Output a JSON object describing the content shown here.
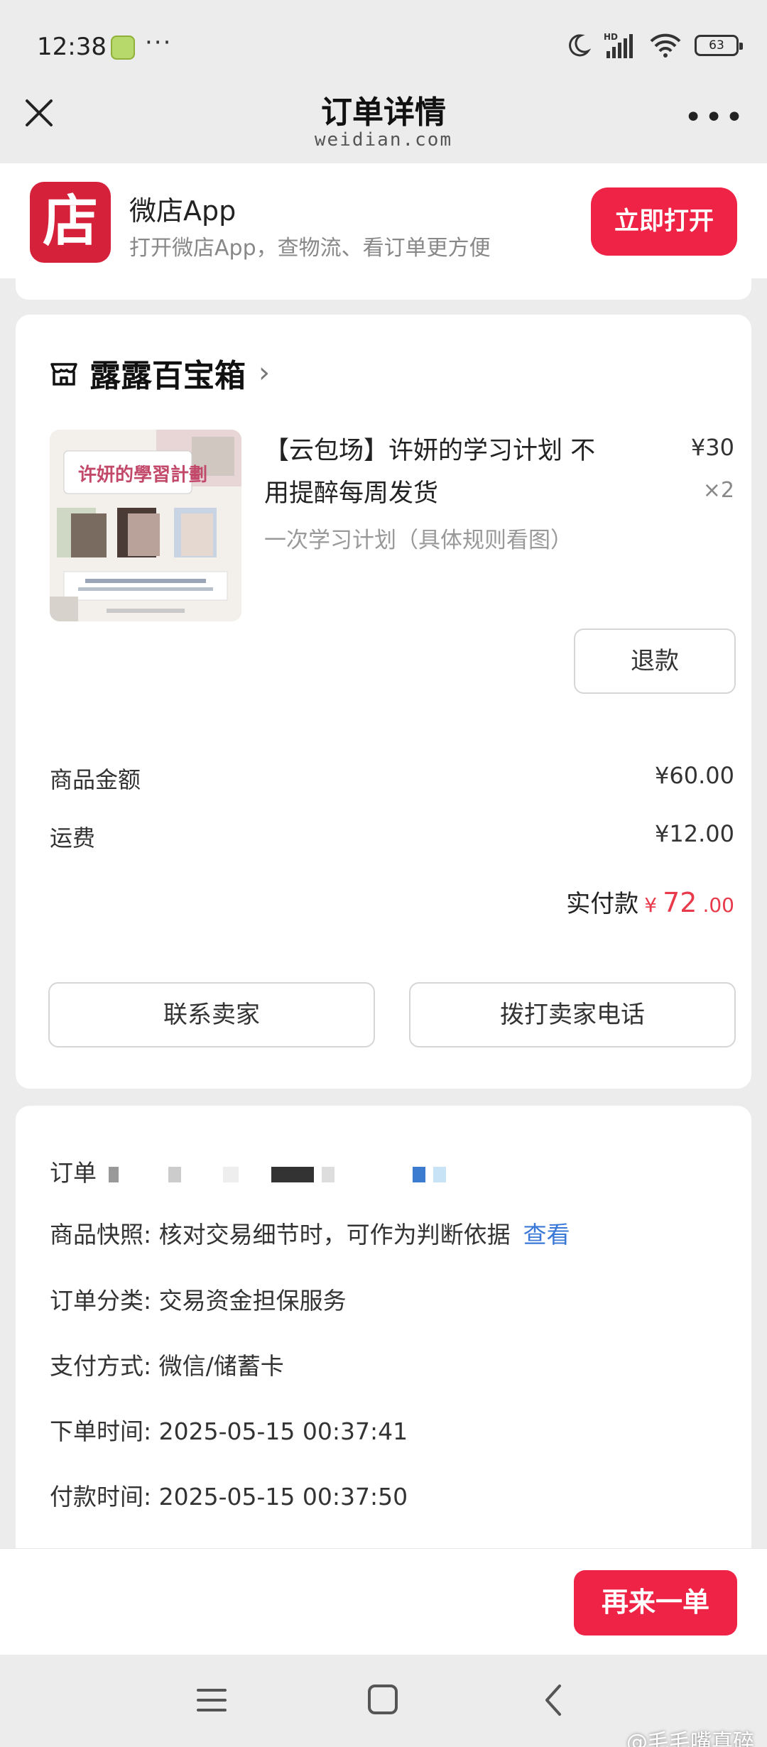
{
  "status_bar": {
    "time": "12:38",
    "more": "···",
    "battery": "63"
  },
  "nav": {
    "title": "订单详情",
    "subtitle": "weidian.com",
    "more": "•••"
  },
  "app_banner": {
    "logo_char": "店",
    "name": "微店App",
    "description": "打开微店App，查物流、看订单更方便",
    "open_label": "立即打开"
  },
  "shop": {
    "name": "露露百宝箱",
    "chevron": "›"
  },
  "product": {
    "title": "【云包场】许妍的学习计划 不用提醉每周发货",
    "price": "¥30",
    "quantity": "×2",
    "spec": "一次学习计划（具体规则看图）",
    "image_caption": "许妍的學習計劃",
    "refund_label": "退款"
  },
  "summary": {
    "goods_label": "商品金额",
    "goods_value": "¥60.00",
    "shipping_label": "运费",
    "shipping_value": "¥12.00",
    "paid_label": "实付款",
    "paid_currency": "¥",
    "paid_integer": "72",
    "paid_decimal": ".00"
  },
  "actions": {
    "contact_seller": "联系卖家",
    "call_seller": "拨打卖家电话"
  },
  "order_info": {
    "order_no_label": "订单",
    "snapshot_label": "商品快照: 核对交易细节时，可作为判断依据",
    "snapshot_link": "查看",
    "category": "订单分类: 交易资金担保服务",
    "payment_method": "支付方式: 微信/储蓄卡",
    "order_time": "下单时间: 2025-05-15 00:37:41",
    "pay_time": "付款时间: 2025-05-15 00:37:50"
  },
  "bottom": {
    "reorder_label": "再来一单"
  },
  "watermark": "@毛毛嘴真碎",
  "colors": {
    "accent": "#ee2346",
    "price_red": "#e83a4b",
    "link_blue": "#3a78d8",
    "logo_red": "#d6213a"
  }
}
